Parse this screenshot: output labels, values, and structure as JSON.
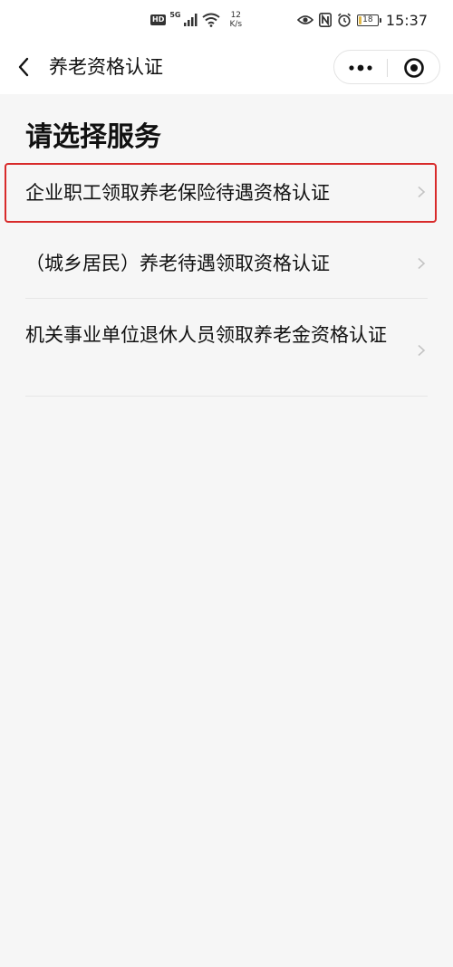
{
  "status_bar": {
    "hd_label": "HD",
    "network_type": "5G",
    "net_speed_value": "12",
    "net_speed_unit": "K/s",
    "battery_level": "18",
    "battery_fraction": 0.18,
    "time": "15:37",
    "icons": [
      "signal-icon",
      "wifi-icon",
      "eye-icon",
      "nfc-icon",
      "alarm-icon",
      "battery-icon"
    ]
  },
  "nav": {
    "title": "养老资格认证",
    "back_icon": "back-arrow-icon",
    "more_icon": "more-dots-icon",
    "close_icon": "target-close-icon"
  },
  "page": {
    "heading": "请选择服务"
  },
  "services": [
    {
      "label": "企业职工领取养老保险待遇资格认证",
      "highlighted": true
    },
    {
      "label": "（城乡居民）养老待遇领取资格认证",
      "highlighted": false
    },
    {
      "label": "机关事业单位退休人员领取养老金资格认证",
      "highlighted": false
    }
  ],
  "colors": {
    "highlight": "#d82a2a",
    "background": "#f6f6f6",
    "chevron": "#c4c4c4"
  }
}
